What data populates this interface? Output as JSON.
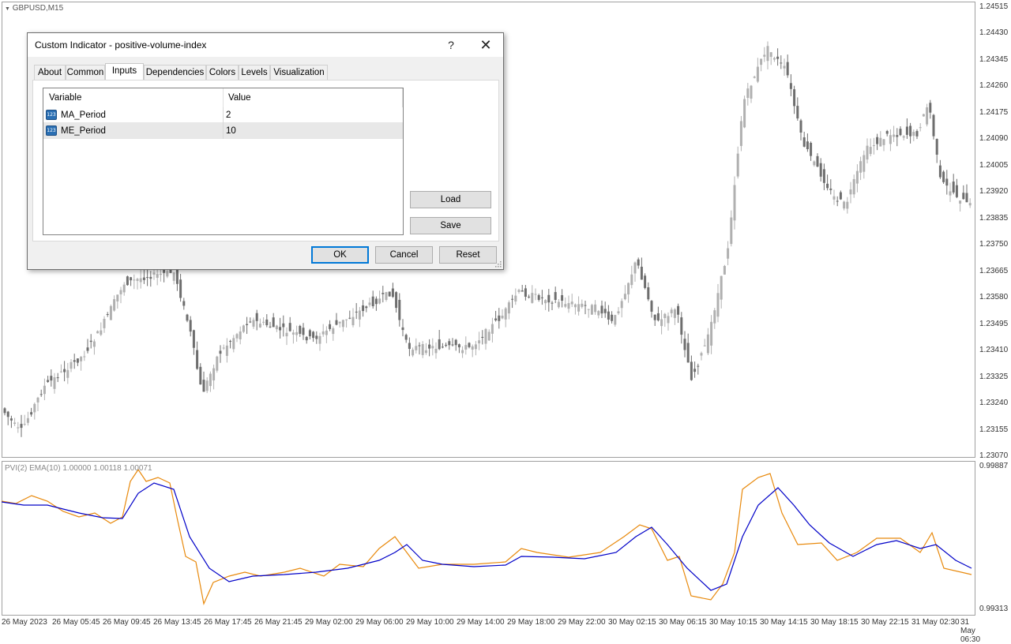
{
  "chart": {
    "symbol": "GBPUSD,M15",
    "price_ticks": [
      "1.24515",
      "1.24430",
      "1.24345",
      "1.24260",
      "1.24175",
      "1.24090",
      "1.24005",
      "1.23920",
      "1.23835",
      "1.23750",
      "1.23665",
      "1.23580",
      "1.23495",
      "1.23410",
      "1.23325",
      "1.23240",
      "1.23155",
      "1.23070"
    ],
    "indicator_label": "PVI(2)  EMA(10) 1.00000 1.00118 1.00071",
    "indicator_ticks": [
      "0.99887",
      "0.99313"
    ],
    "time_ticks": [
      "26 May 2023",
      "26 May 05:45",
      "26 May 09:45",
      "26 May 13:45",
      "26 May 17:45",
      "26 May 21:45",
      "29 May 02:00",
      "29 May 06:00",
      "29 May 10:00",
      "29 May 14:00",
      "29 May 18:00",
      "29 May 22:00",
      "30 May 02:15",
      "30 May 06:15",
      "30 May 10:15",
      "30 May 14:15",
      "30 May 18:15",
      "30 May 22:15",
      "31 May 02:30",
      "31 May 06:30"
    ],
    "colors": {
      "bull_candle": "#b0b0b0",
      "bear_candle": "#6e6e6e",
      "pvi_line": "#e8890c",
      "ema_line": "#0000c8"
    }
  },
  "dialog": {
    "title": "Custom Indicator - positive-volume-index",
    "help_label": "?",
    "close_label": "✕",
    "tabs": [
      {
        "label": "About"
      },
      {
        "label": "Common"
      },
      {
        "label": "Inputs"
      },
      {
        "label": "Dependencies"
      },
      {
        "label": "Colors"
      },
      {
        "label": "Levels"
      },
      {
        "label": "Visualization"
      }
    ],
    "active_tab": "Inputs",
    "grid": {
      "headers": [
        "Variable",
        "Value"
      ],
      "rows": [
        {
          "icon": "123",
          "variable": "MA_Period",
          "value": "2"
        },
        {
          "icon": "123",
          "variable": "ME_Period",
          "value": "10"
        }
      ]
    },
    "buttons": {
      "load": "Load",
      "save": "Save",
      "ok": "OK",
      "cancel": "Cancel",
      "reset": "Reset"
    }
  }
}
